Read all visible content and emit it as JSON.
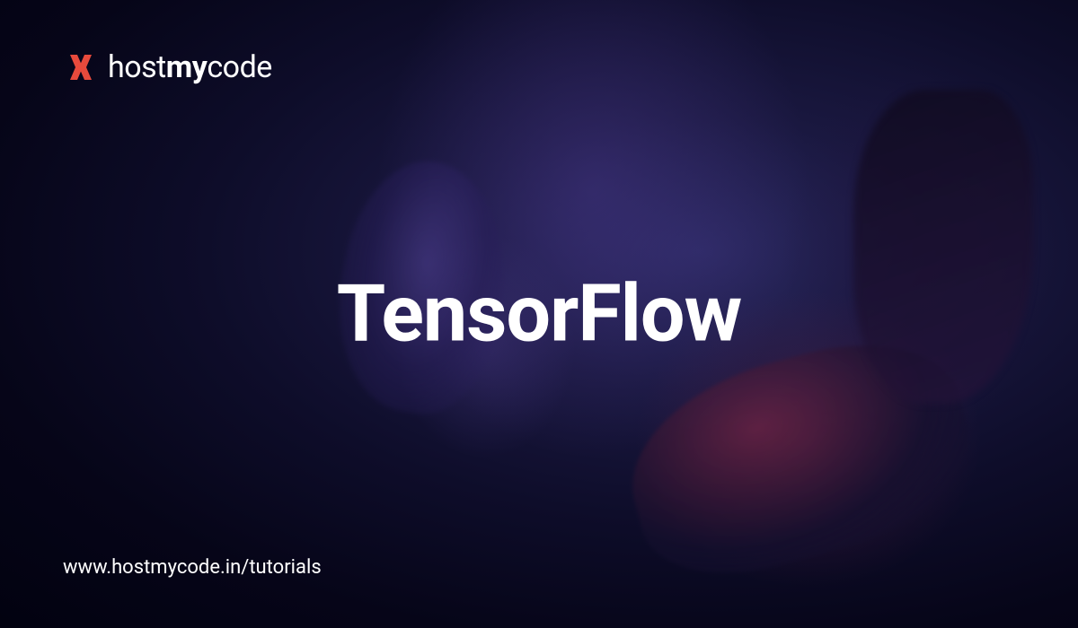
{
  "logo": {
    "text_part1": "host",
    "text_part2": "my",
    "text_part3": "code",
    "icon_color": "#E84A3C"
  },
  "main": {
    "title": "TensorFlow"
  },
  "footer": {
    "url": "www.hostmycode.in/tutorials"
  }
}
